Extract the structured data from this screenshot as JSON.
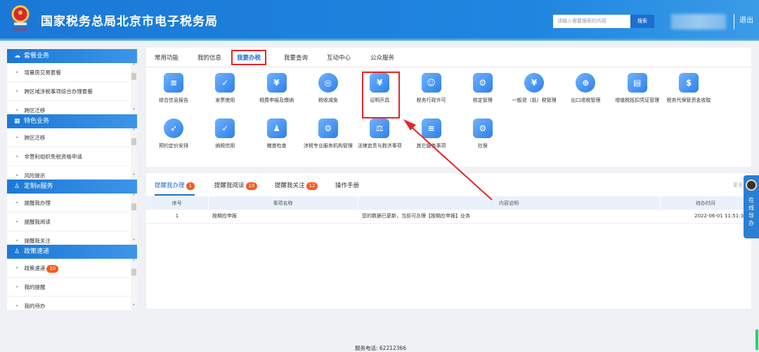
{
  "header": {
    "title": "国家税务总局北京市电子税务局",
    "search_placeholder": "请输入需要搜索的内容",
    "search_button": "搜索",
    "logout": "退出"
  },
  "sidebar": [
    {
      "title": "套餐业务",
      "icon": "cloud-icon",
      "items": [
        "增量房交易套餐",
        "跨区域涉税事项综合办理套餐",
        "跨区迁移"
      ]
    },
    {
      "title": "特色业务",
      "icon": "grid-icon",
      "items": [
        "跨区迁移",
        "非营利组织免税资格申请",
        "风险提示"
      ]
    },
    {
      "title": "定制e服务",
      "icon": "user-icon",
      "items": [
        "提醒我办理",
        "提醒我阅读",
        "提醒我关注"
      ]
    },
    {
      "title": "政策速递",
      "icon": "user-icon",
      "items": [
        "政策速递",
        "我的提醒",
        "我的待办"
      ],
      "badge": "10"
    }
  ],
  "main": {
    "tabs": [
      "常用功能",
      "我的信息",
      "我要办税",
      "我要查询",
      "互动中心",
      "公众服务"
    ],
    "active_tab": "我要办税",
    "functions": [
      {
        "label": "综合信息报告",
        "glyph": "≡"
      },
      {
        "label": "发票使用",
        "glyph": "✓"
      },
      {
        "label": "税费申报及缴纳",
        "glyph": "¥"
      },
      {
        "label": "税收减免",
        "glyph": "◎"
      },
      {
        "label": "证明开具",
        "glyph": "¥"
      },
      {
        "label": "税务行政许可",
        "glyph": "☺"
      },
      {
        "label": "核定管理",
        "glyph": "⚙"
      },
      {
        "label": "一般退（抵）税管理",
        "glyph": "¥"
      },
      {
        "label": "出口退税管理",
        "glyph": "⊕"
      },
      {
        "label": "增值税抵扣凭证管理",
        "glyph": "▤"
      },
      {
        "label": "税务代保管资金收取",
        "glyph": "$"
      },
      {
        "label": "预约定价安排",
        "glyph": "➶"
      },
      {
        "label": "纳税信用",
        "glyph": "✓"
      },
      {
        "label": "稽查检查",
        "glyph": "♟"
      },
      {
        "label": "涉税专业服务机构管理",
        "glyph": "⚙"
      },
      {
        "label": "法律追责与救济事项",
        "glyph": "⚖"
      },
      {
        "label": "其它服务事项",
        "glyph": "≡"
      },
      {
        "label": "社保",
        "glyph": "⚙"
      }
    ]
  },
  "reminders": {
    "tabs": [
      {
        "label": "提醒我办理",
        "badge": "1"
      },
      {
        "label": "提醒我阅读",
        "badge": "10"
      },
      {
        "label": "提醒我关注",
        "badge": "12"
      },
      {
        "label": "操作手册"
      }
    ],
    "more": "更多>",
    "columns": [
      "序号",
      "事项名称",
      "内容说明",
      "待办时间"
    ],
    "rows": [
      [
        "1",
        "按期应申报",
        "您的数据已更新，当前可办理【按期应申报】业务",
        "2022-06-01 11:51:34"
      ]
    ]
  },
  "float_widget": "在线导办",
  "footer": "服务电话: 62212366",
  "colors": {
    "brand": "#1b78d6",
    "highlight": "#e5252a",
    "badge": "#f55a1f"
  }
}
